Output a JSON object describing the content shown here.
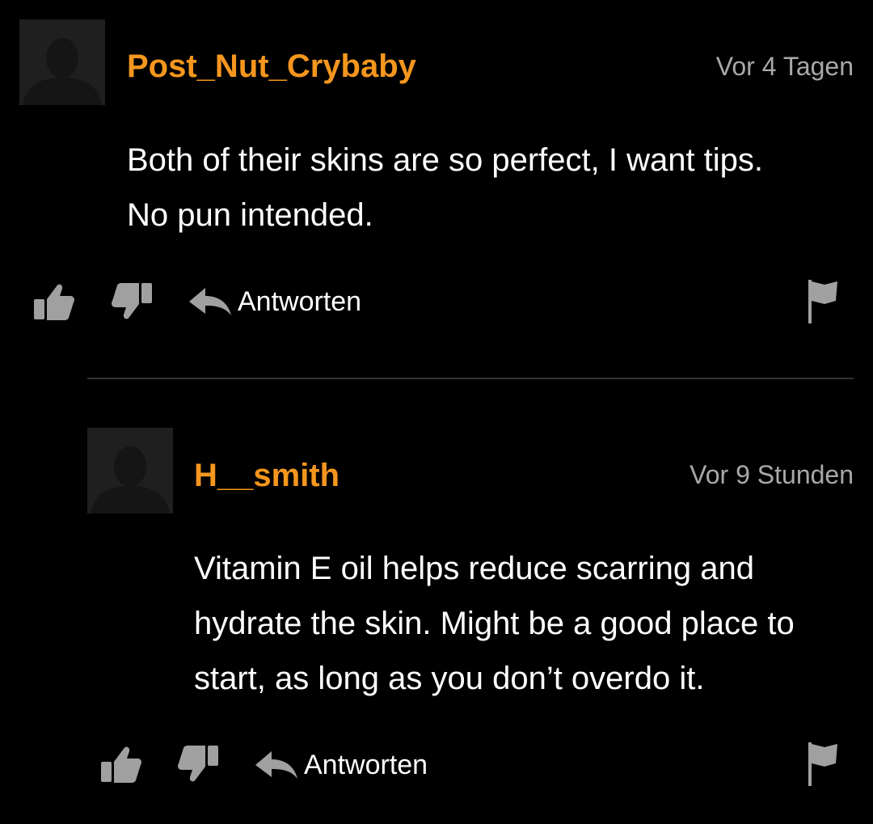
{
  "comments": [
    {
      "username": "Post_Nut_Crybaby",
      "time": "Vor 4 Tagen",
      "text": "Both of their skins are so perfect, I want tips. No pun intended.",
      "reply_label": "Antworten"
    },
    {
      "username": "H__smith",
      "time": "Vor 9 Stunden",
      "text": "Vitamin E oil helps reduce scarring and hydrate the skin. Might be a good place to start, as long as you don’t overdo it.",
      "reply_label": "Antworten"
    }
  ],
  "colors": {
    "background": "#000000",
    "username": "#f5961e",
    "timestamp": "#a8a8a8",
    "icon": "#a0a0a0",
    "divider": "#333333"
  },
  "icons": [
    "avatar-silhouette",
    "thumbs-up-icon",
    "thumbs-down-icon",
    "reply-arrow-icon",
    "flag-icon"
  ]
}
